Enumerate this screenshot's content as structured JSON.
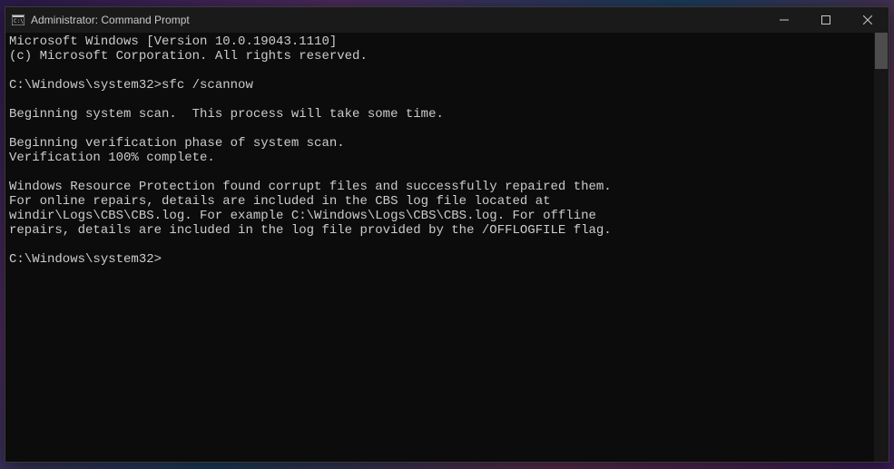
{
  "titlebar": {
    "title": "Administrator: Command Prompt"
  },
  "terminal": {
    "lines": [
      "Microsoft Windows [Version 10.0.19043.1110]",
      "(c) Microsoft Corporation. All rights reserved.",
      "",
      "C:\\Windows\\system32>sfc /scannow",
      "",
      "Beginning system scan.  This process will take some time.",
      "",
      "Beginning verification phase of system scan.",
      "Verification 100% complete.",
      "",
      "Windows Resource Protection found corrupt files and successfully repaired them.",
      "For online repairs, details are included in the CBS log file located at",
      "windir\\Logs\\CBS\\CBS.log. For example C:\\Windows\\Logs\\CBS\\CBS.log. For offline",
      "repairs, details are included in the log file provided by the /OFFLOGFILE flag.",
      "",
      "C:\\Windows\\system32>"
    ]
  }
}
